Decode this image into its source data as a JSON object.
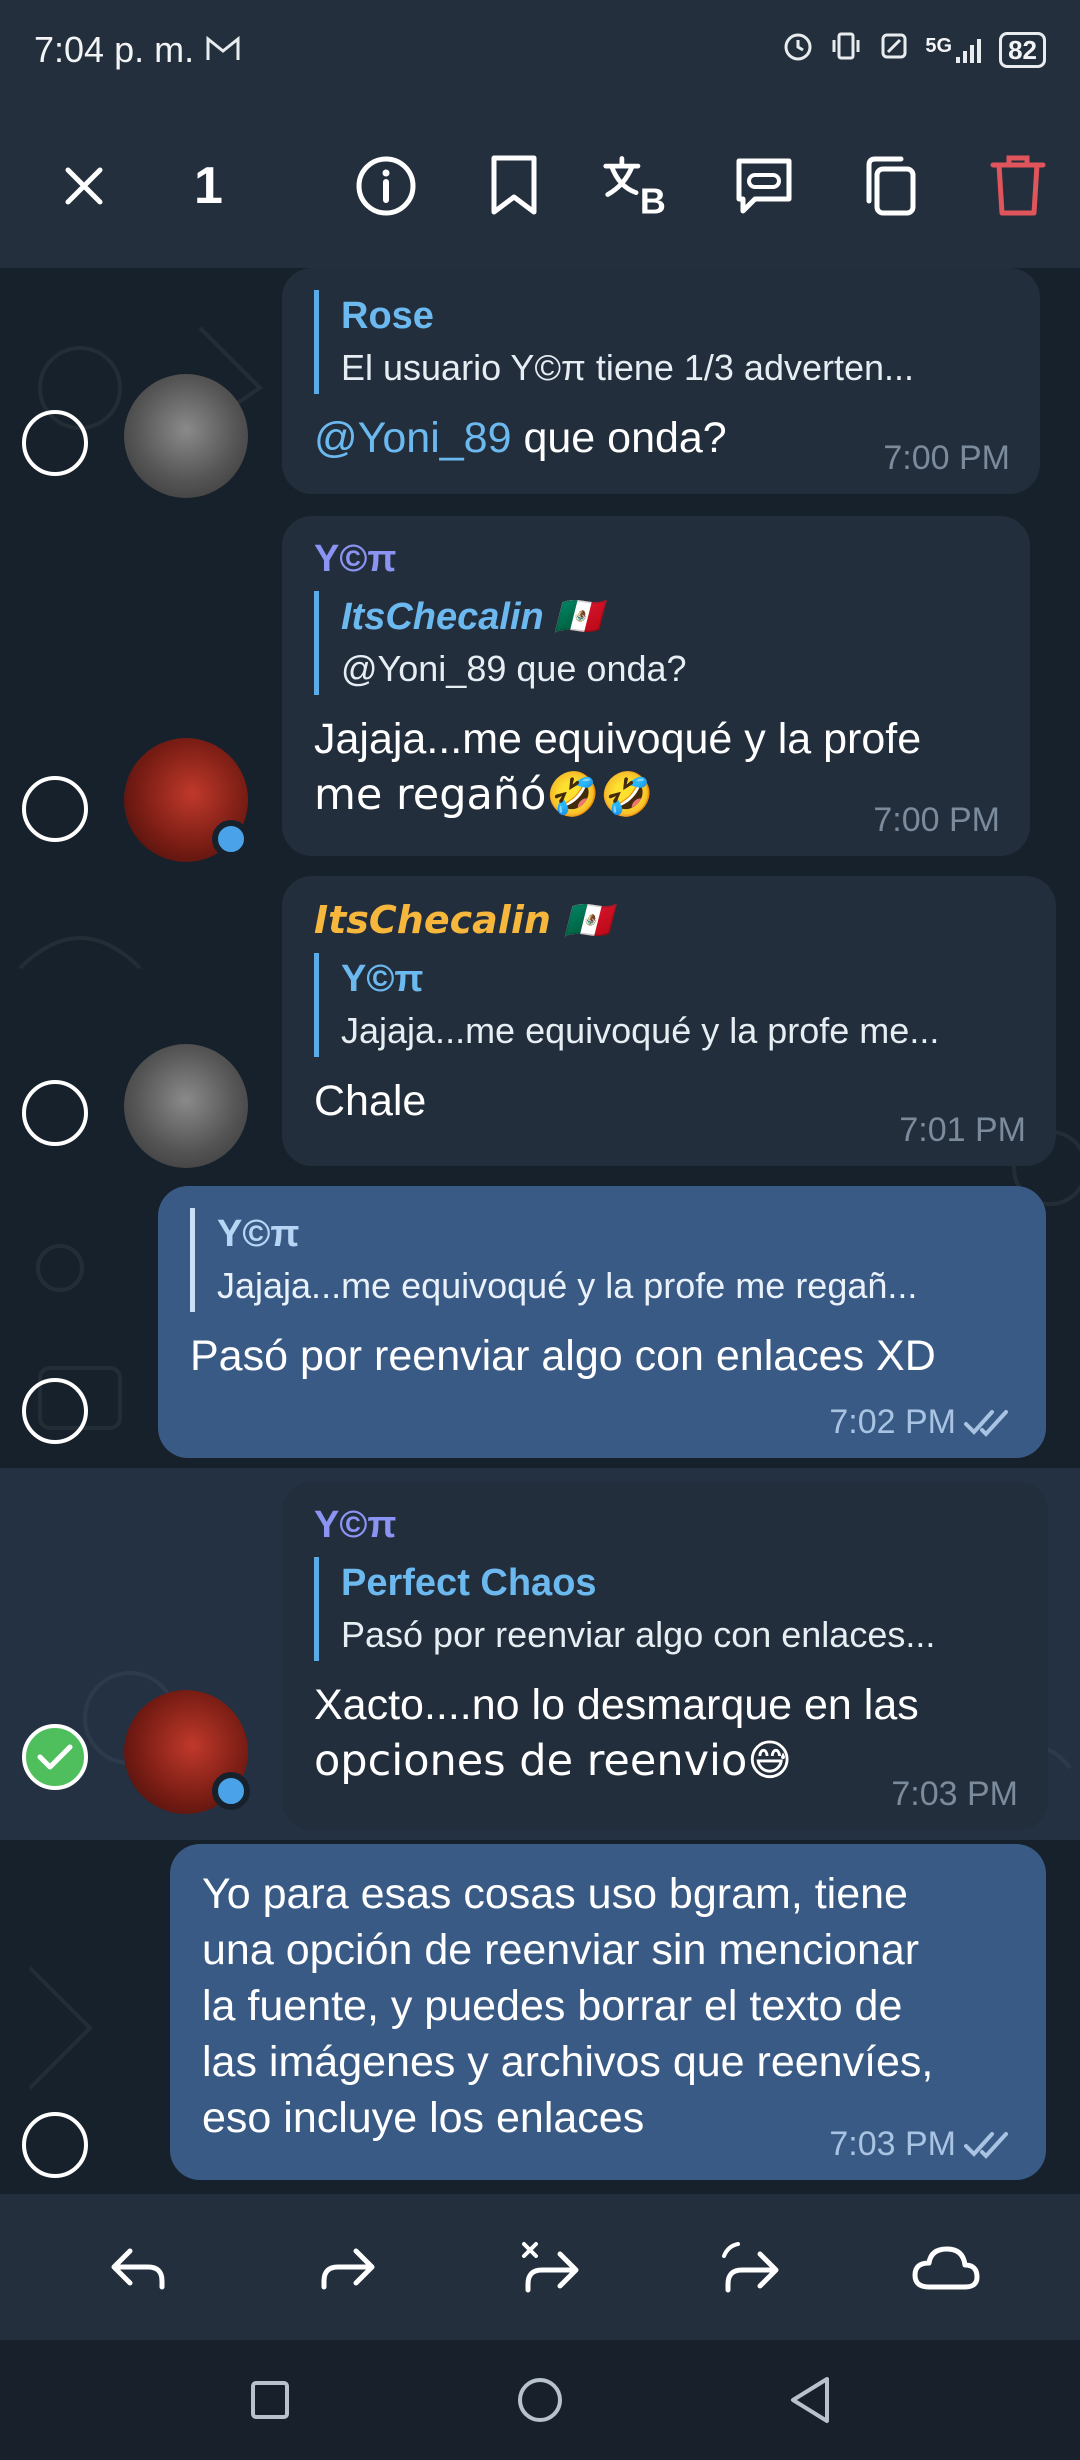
{
  "status_bar": {
    "time": "7:04 p. m.",
    "network": "5G",
    "battery": "82"
  },
  "action_bar": {
    "selected_count": "1"
  },
  "messages": [
    {
      "sender": "",
      "reply_name": "Rose",
      "reply_text": "El usuario Y©π tiene 1/3 adverten...",
      "mention": "@Yoni_89",
      "text": " que onda?",
      "time": "7:00 PM"
    },
    {
      "sender": "Y©π",
      "reply_name": "ItsChecalin 🇲🇽",
      "reply_text": "@Yoni_89 que onda?",
      "text_line1": "Jajaja...me equivoqué y la profe",
      "text_line2": "me regañó🤣🤣",
      "time": "7:00 PM"
    },
    {
      "sender": "ItsChecalin 🇲🇽",
      "reply_name": "Y©π",
      "reply_text": "Jajaja...me equivoqué y la profe me...",
      "text": "Chale",
      "time": "7:01 PM"
    },
    {
      "reply_name": "Y©π",
      "reply_text": "Jajaja...me equivoqué y la profe me regañ...",
      "text": "Pasó por reenviar algo con enlaces XD",
      "time": "7:02 PM"
    },
    {
      "sender": "Y©π",
      "reply_name": "Perfect Chaos",
      "reply_text": "Pasó por reenviar algo con enlaces...",
      "text_line1": "Xacto....no lo desmarque en las",
      "text_line2": "opciones de reenvio😅",
      "time": "7:03 PM"
    },
    {
      "text_line1": "Yo para esas cosas uso bgram, tiene",
      "text_line2": "una opción de reenviar sin mencionar",
      "text_line3": "la fuente, y puedes borrar el texto de",
      "text_line4": "las imágenes y archivos que reenvíes,",
      "text_line5": "eso incluye los enlaces",
      "time": "7:03 PM"
    }
  ],
  "colors": {
    "accent": "#5aabe6",
    "sender_yoni": "#8b93f3",
    "sender_checalin": "#f6b73c",
    "delete": "#e0545b",
    "selected_check": "#4fbf5e"
  },
  "icons": {
    "action_bar": [
      "close-icon",
      "info-icon",
      "bookmark-icon",
      "translate-icon",
      "link-copy-icon",
      "copy-icon",
      "delete-icon"
    ],
    "bottom_bar": [
      "reply-icon",
      "forward-icon",
      "forward-no-quote-icon",
      "share-icon",
      "cloud-icon"
    ],
    "nav_bar": [
      "recents-icon",
      "home-icon",
      "back-icon"
    ]
  }
}
